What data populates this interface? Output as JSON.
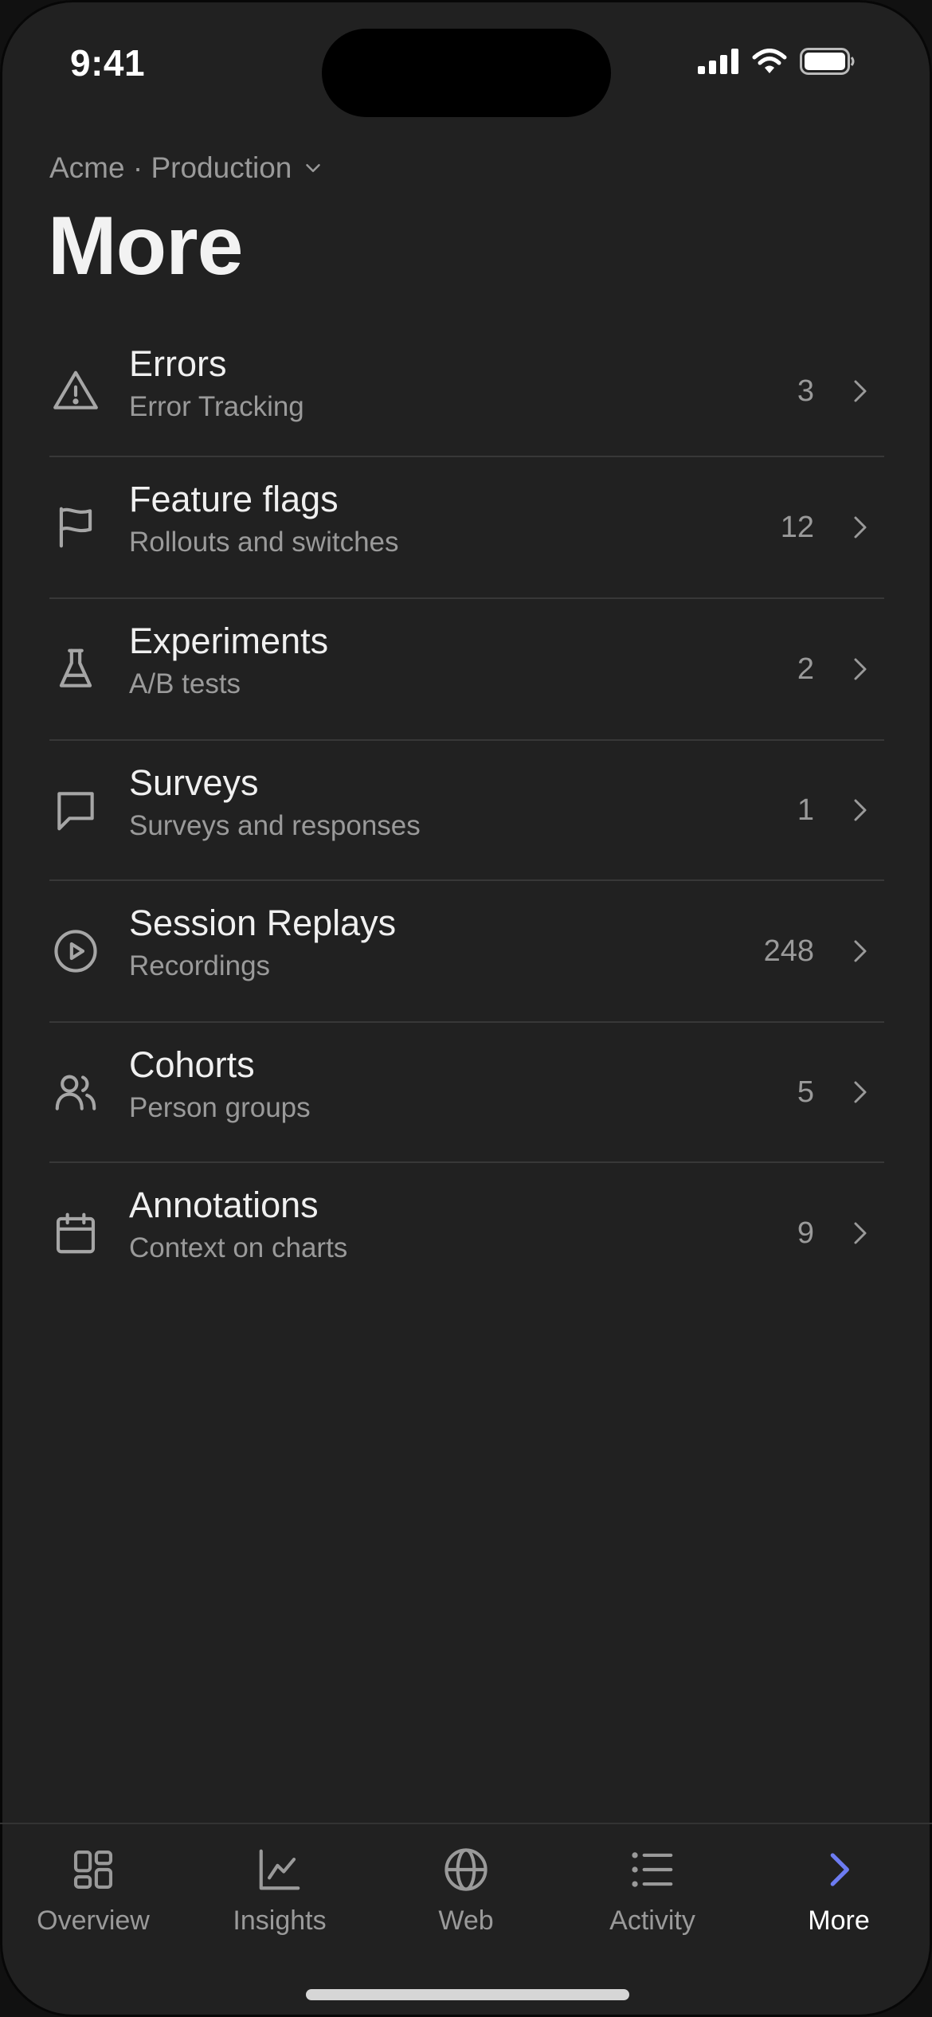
{
  "status_bar": {
    "time": "9:41"
  },
  "header": {
    "project": "Acme · Production",
    "title": "More"
  },
  "menu": [
    {
      "icon": "warning-triangle-icon",
      "title": "Errors",
      "subtitle": "Error Tracking",
      "count": "3"
    },
    {
      "icon": "flag-icon",
      "title": "Feature flags",
      "subtitle": "Rollouts and switches",
      "count": "12"
    },
    {
      "icon": "flask-icon",
      "title": "Experiments",
      "subtitle": "A/B tests",
      "count": "2"
    },
    {
      "icon": "chat-bubble-icon",
      "title": "Surveys",
      "subtitle": "Surveys and responses",
      "count": "1"
    },
    {
      "icon": "play-circle-icon",
      "title": "Session Replays",
      "subtitle": "Recordings",
      "count": "248"
    },
    {
      "icon": "users-icon",
      "title": "Cohorts",
      "subtitle": "Person groups",
      "count": "5"
    },
    {
      "icon": "calendar-icon",
      "title": "Annotations",
      "subtitle": "Context on charts",
      "count": "9"
    }
  ],
  "tab_bar": {
    "tabs": [
      {
        "icon": "grid-icon",
        "label": "Overview"
      },
      {
        "icon": "line-chart-icon",
        "label": "Insights"
      },
      {
        "icon": "globe-icon",
        "label": "Web"
      },
      {
        "icon": "list-icon",
        "label": "Activity"
      },
      {
        "icon": "chevron-right-icon",
        "label": "More"
      }
    ],
    "active": "More"
  },
  "colors": {
    "background": "#212121",
    "accent": "#6d7cf2",
    "text_primary": "#f0f0f0",
    "text_secondary": "#9a9a9a"
  }
}
